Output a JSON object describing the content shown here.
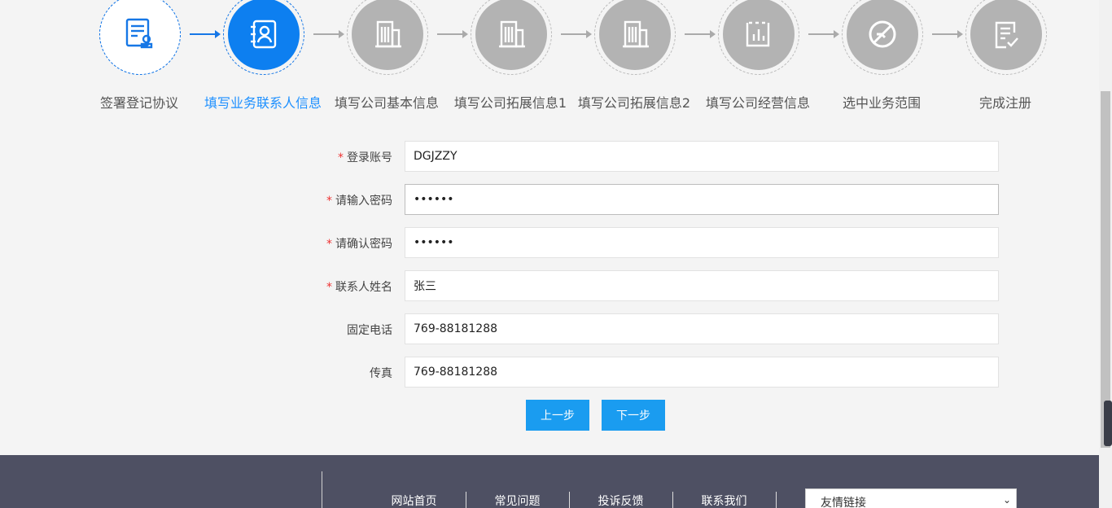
{
  "steps": [
    {
      "label": "签署登记协议",
      "icon": "contract-stamp-icon",
      "state": "done"
    },
    {
      "label": "填写业务联系人信息",
      "icon": "contact-book-icon",
      "state": "active"
    },
    {
      "label": "填写公司基本信息",
      "icon": "building-icon",
      "state": "pending"
    },
    {
      "label": "填写公司拓展信息1",
      "icon": "building-icon",
      "state": "pending"
    },
    {
      "label": "填写公司拓展信息2",
      "icon": "building-icon",
      "state": "pending"
    },
    {
      "label": "填写公司经营信息",
      "icon": "bar-chart-icon",
      "state": "pending"
    },
    {
      "label": "选中业务范围",
      "icon": "no-entry-icon",
      "state": "pending"
    },
    {
      "label": "完成注册",
      "icon": "checklist-icon",
      "state": "pending"
    }
  ],
  "form": {
    "account": {
      "label": "登录账号",
      "value": "DGJZZY",
      "required": "*"
    },
    "password": {
      "label": "请输入密码",
      "value": "••••••",
      "required": "*"
    },
    "confirm": {
      "label": "请确认密码",
      "value": "••••••",
      "required": "*"
    },
    "contact": {
      "label": "联系人姓名",
      "value": "张三",
      "required": "*"
    },
    "phone": {
      "label": "固定电话",
      "value": "769-88181288"
    },
    "fax": {
      "label": "传真",
      "value": "769-88181288"
    }
  },
  "buttons": {
    "prev": "上一步",
    "next": "下一步"
  },
  "footer": {
    "nav": [
      "网站首页",
      "常见问题",
      "投诉反馈",
      "联系我们"
    ],
    "links_select": "友情链接"
  },
  "colors": {
    "accent": "#0d7ff0",
    "button": "#1a9cf0",
    "footer": "#4e5063",
    "required": "#e33"
  }
}
